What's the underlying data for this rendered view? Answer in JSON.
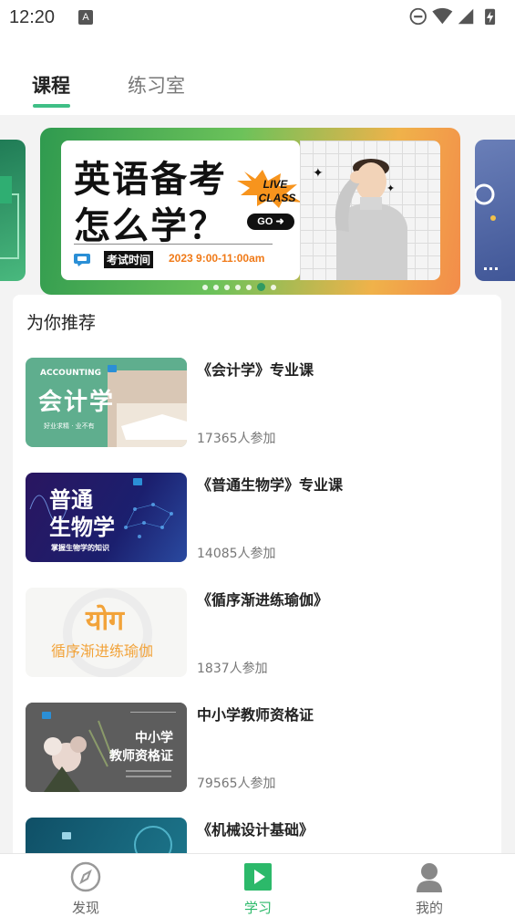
{
  "status_bar": {
    "time": "12:20",
    "notification_icon": "A"
  },
  "tabs": [
    {
      "label": "课程",
      "active": true
    },
    {
      "label": "练习室",
      "active": false
    }
  ],
  "banner": {
    "headline_line1": "英语备考",
    "headline_line2": "怎么学？",
    "live_badge_line1": "LIVE",
    "live_badge_line2": "CLASS",
    "go_label": "GO ➜",
    "exam_label": "考试时间",
    "exam_date": "2023 9:00-11:00am",
    "slide_count": 7,
    "active_slide": 6
  },
  "recommend": {
    "title": "为你推荐",
    "courses": [
      {
        "name": "《会计学》专业课",
        "count": "17365人参加",
        "thumb_title": "会计学",
        "thumb_subtitle": "ACCOUNTING",
        "thumb_caption": "好业求精 · 业不有"
      },
      {
        "name": "《普通生物学》专业课",
        "count": "14085人参加",
        "thumb_title_line1": "普通",
        "thumb_title_line2": "生物学",
        "thumb_caption": "掌握生物学的知识"
      },
      {
        "name": "《循序渐进练瑜伽》",
        "count": "1837人参加",
        "thumb_title": "योग",
        "thumb_subtitle": "循序渐进练瑜伽"
      },
      {
        "name": "中小学教师资格证",
        "count": "79565人参加",
        "thumb_title_line1": "中小学",
        "thumb_title_line2": "教师资格证"
      },
      {
        "name": "《机械设计基础》",
        "count": "",
        "thumb_title": ""
      }
    ]
  },
  "bottom_nav": [
    {
      "label": "发现",
      "icon": "compass-icon",
      "active": false
    },
    {
      "label": "学习",
      "icon": "play-icon",
      "active": true
    },
    {
      "label": "我的",
      "icon": "user-icon",
      "active": false
    }
  ],
  "colors": {
    "accent": "#2cb96a",
    "tab_underline": "#3fbf86"
  }
}
